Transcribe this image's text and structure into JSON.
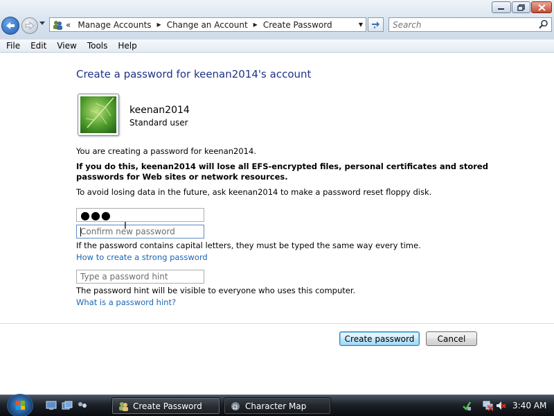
{
  "window": {
    "minimize_icon": "minimize-icon",
    "maximize_icon": "maximize-icon",
    "close_icon": "close-icon"
  },
  "address": {
    "breadcrumb_overflow": "«",
    "crumbs": [
      "Manage Accounts",
      "Change an Account",
      "Create Password"
    ],
    "search_placeholder": "Search"
  },
  "menu": [
    "File",
    "Edit",
    "View",
    "Tools",
    "Help"
  ],
  "page": {
    "title": "Create a password for keenan2014's account",
    "account_name": "keenan2014",
    "account_type": "Standard user",
    "info_creating": "You are creating a password for keenan2014.",
    "warning": "If you do this, keenan2014 will lose all EFS-encrypted files, personal certificates and stored passwords for Web sites or network resources.",
    "info_avoid": "To avoid losing data in the future, ask keenan2014 to make a password reset floppy disk.",
    "new_password_value": "●●●",
    "confirm_placeholder": "Confirm new password",
    "case_note": "If the password contains capital letters, they must be typed the same way every time.",
    "strong_link": "How to create a strong password",
    "hint_placeholder": "Type a password hint",
    "hint_note": "The password hint will be visible to everyone who uses this computer.",
    "hint_link": "What is a password hint?",
    "create_button": "Create password",
    "cancel_button": "Cancel"
  },
  "taskbar": {
    "tasks": [
      "Create Password",
      "Character Map"
    ],
    "clock": "3:40 AM"
  },
  "colors": {
    "title_text": "#1e3287",
    "link": "#1a64b4"
  }
}
